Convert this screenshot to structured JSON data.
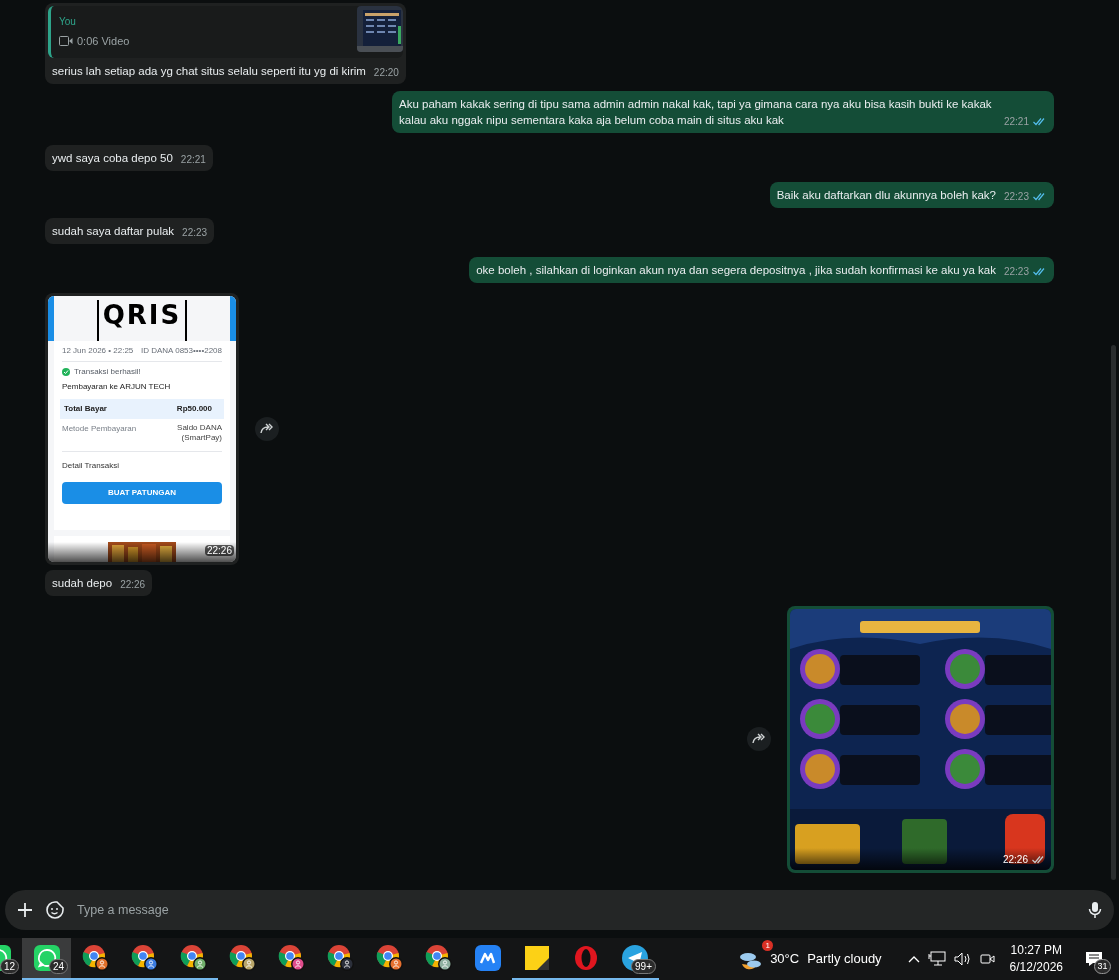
{
  "messages": [
    {
      "kind": "quoted",
      "outgoing": false,
      "quote": {
        "author": "You",
        "media": "0:06 Video"
      },
      "text": "serius lah setiap ada yg chat situs selalu seperti itu yg di kirim",
      "time": "22:20"
    },
    {
      "kind": "text",
      "outgoing": true,
      "text": "Aku paham kakak sering di tipu sama admin admin nakal kak, tapi ya gimana cara nya aku bisa kasih bukti ke kakak kalau aku nggak nipu sementara kaka aja belum coba main di situs aku kak",
      "time": "22:21",
      "read": true
    },
    {
      "kind": "text",
      "outgoing": false,
      "text": "ywd saya coba depo 50",
      "time": "22:21"
    },
    {
      "kind": "text",
      "outgoing": true,
      "text": "Baik aku daftarkan dlu akunnya boleh kak?",
      "time": "22:23",
      "read": true
    },
    {
      "kind": "text",
      "outgoing": false,
      "text": "sudah saya daftar pulak",
      "time": "22:23"
    },
    {
      "kind": "text",
      "outgoing": true,
      "text": "oke boleh , silahkan di loginkan akun nya dan segera depositnya , jika sudah konfirmasi ke aku ya kak",
      "time": "22:23",
      "read": true
    },
    {
      "kind": "receipt",
      "outgoing": false,
      "time": "22:26",
      "receipt": {
        "logo": "QRIS",
        "datetime": "12 Jun 2026 • 22:25",
        "account": "ID DANA 0853••••2208",
        "status": "Transaksi berhasil!",
        "payee": "Pembayaran ke ARJUN TECH",
        "total_label": "Total Bayar",
        "total": "Rp50.000",
        "method_label": "Metode Pembayaran",
        "method": [
          "Saldo DANA",
          "(SmartPay)"
        ],
        "details": "Detail Transaksi",
        "action": "BUAT PATUNGAN"
      }
    },
    {
      "kind": "text",
      "outgoing": false,
      "text": "sudah depo",
      "time": "22:26"
    },
    {
      "outgoing": true,
      "time": "22:26",
      "read": false
    }
  ],
  "composer": {
    "placeholder": "Type a message"
  },
  "taskbar": {
    "apps": [
      {
        "kind": "whatsapp",
        "badge": "12",
        "selected": false,
        "running": false
      },
      {
        "kind": "whatsapp",
        "badge": "24",
        "selected": true,
        "running": true
      },
      {
        "kind": "chrome",
        "color": "#e0702a",
        "selected": false,
        "running": true
      },
      {
        "kind": "chrome",
        "color": "#3b7be0",
        "selected": false,
        "running": true
      },
      {
        "kind": "chrome",
        "color": "#6fae6a",
        "selected": false,
        "running": true
      },
      {
        "kind": "chrome",
        "color": "#b9a66a",
        "selected": false,
        "running": false
      },
      {
        "kind": "chrome",
        "color": "#e04c8c",
        "selected": false,
        "running": false
      },
      {
        "kind": "chrome",
        "color": "#2b2f3a",
        "selected": false,
        "running": false
      },
      {
        "kind": "chrome",
        "color": "#e6702f",
        "selected": false,
        "running": false
      },
      {
        "kind": "chrome",
        "color": "#8fb0a0",
        "selected": false,
        "running": false
      },
      {
        "kind": "mtask",
        "selected": false,
        "running": false
      },
      {
        "kind": "sticky",
        "selected": false,
        "running": true
      },
      {
        "kind": "opera",
        "selected": false,
        "running": true
      },
      {
        "kind": "telegram",
        "badge": "99+",
        "selected": false,
        "running": true
      }
    ],
    "weather": {
      "badge": "1",
      "temperature": "30°C",
      "condition": "Partly cloudy"
    },
    "clock": {
      "time": "10:27 PM",
      "date": "6/12/2026"
    },
    "notifications": "31"
  }
}
